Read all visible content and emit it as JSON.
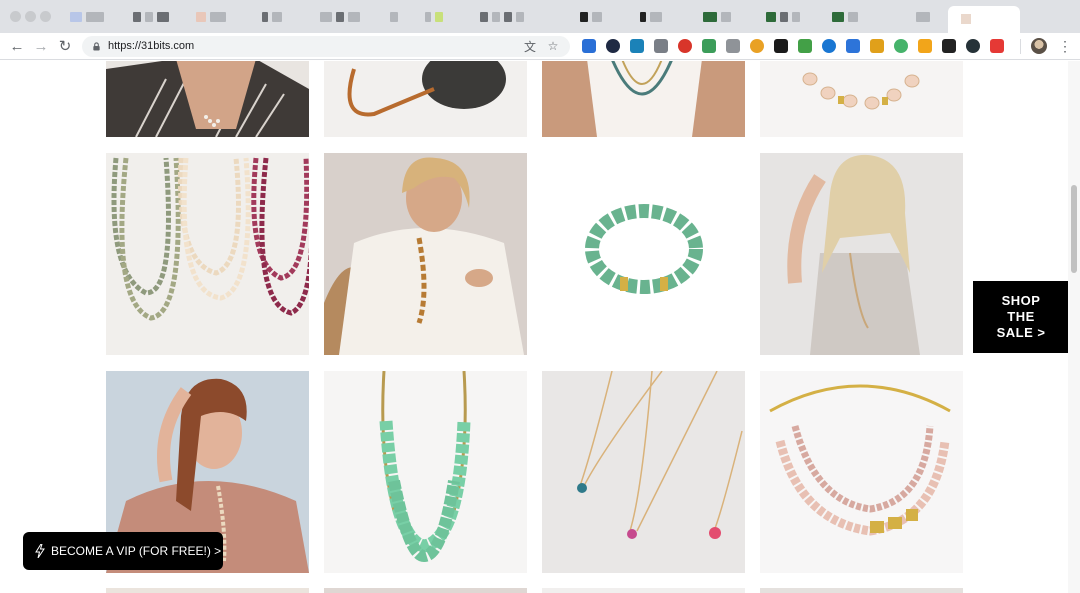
{
  "browser": {
    "url": "https://31bits.com",
    "nav": {
      "back_icon": "←",
      "forward_icon": "→",
      "reload_icon": "↻"
    },
    "omnibox_icons": {
      "translate": "文",
      "bookmark": "☆"
    },
    "extensions": [
      {
        "name": "ext-blue-bird",
        "color": "#2a6fd6"
      },
      {
        "name": "ext-k",
        "color": "#1f2a44"
      },
      {
        "name": "ext-teal-target",
        "color": "#1b82b8"
      },
      {
        "name": "ext-image",
        "color": "#7a7f87"
      },
      {
        "name": "ext-ae",
        "color": "#d8352a"
      },
      {
        "name": "ext-green-leaf",
        "color": "#3c9d5a"
      },
      {
        "name": "ext-grey",
        "color": "#8f9398"
      },
      {
        "name": "ext-sun",
        "color": "#e9a125"
      },
      {
        "name": "ext-js",
        "color": "#1b1b1b"
      },
      {
        "name": "ext-bars",
        "color": "#43a047"
      },
      {
        "name": "ext-blue-swirl",
        "color": "#1976d2"
      },
      {
        "name": "ext-lock",
        "color": "#2d74d9"
      },
      {
        "name": "ext-magnifier",
        "color": "#e0a01a"
      },
      {
        "name": "ext-wave",
        "color": "#46b36b"
      },
      {
        "name": "ext-key",
        "color": "#f2a51a"
      },
      {
        "name": "ext-a",
        "color": "#222222"
      },
      {
        "name": "ext-dark-globe",
        "color": "#263238"
      },
      {
        "name": "ext-red",
        "color": "#e53935"
      }
    ],
    "menu_icon": "⋮"
  },
  "page": {
    "products": [
      {
        "label": "product-woman-striped-top",
        "bg": [
          "#e7e1db",
          "#6a5f58"
        ]
      },
      {
        "label": "product-round-bag-leather-strap",
        "bg": [
          "#f2f0ee",
          "#b86b2e"
        ]
      },
      {
        "label": "product-woman-white-tee-necklace",
        "bg": [
          "#c99a7c",
          "#f3ede7"
        ]
      },
      {
        "label": "product-bead-bracelet-pink",
        "bg": [
          "#f6f4f3",
          "#f0d2bf"
        ]
      },
      {
        "label": "product-layered-bead-necklaces",
        "bg": [
          "#f1efec",
          "#a05c6b"
        ]
      },
      {
        "label": "product-woman-blonde-white-blouse",
        "bg": [
          "#d8d0cb",
          "#b77b34"
        ]
      },
      {
        "label": "product-green-bead-bracelet",
        "bg": [
          "#ffffff",
          "#69b38f"
        ]
      },
      {
        "label": "product-woman-blonde-tank-top",
        "bg": [
          "#e6e4e3",
          "#c9a77a"
        ]
      },
      {
        "label": "product-woman-pink-sweater",
        "bg": [
          "#c9d4dd",
          "#c48c7a"
        ]
      },
      {
        "label": "product-mint-bead-necklace",
        "bg": [
          "#f6f5f4",
          "#78cfa6"
        ]
      },
      {
        "label": "product-pendant-necklaces-marble",
        "bg": [
          "#e9e7e6",
          "#d9b27a"
        ]
      },
      {
        "label": "product-pastel-bead-gold-necklace",
        "bg": [
          "#f7f6f6",
          "#e8c0b3"
        ]
      }
    ],
    "shop_sale": {
      "line1": "SHOP",
      "line2": "THE",
      "line3": "SALE >"
    },
    "vip_button": {
      "label": "BECOME A VIP (FOR FREE!) >"
    }
  }
}
